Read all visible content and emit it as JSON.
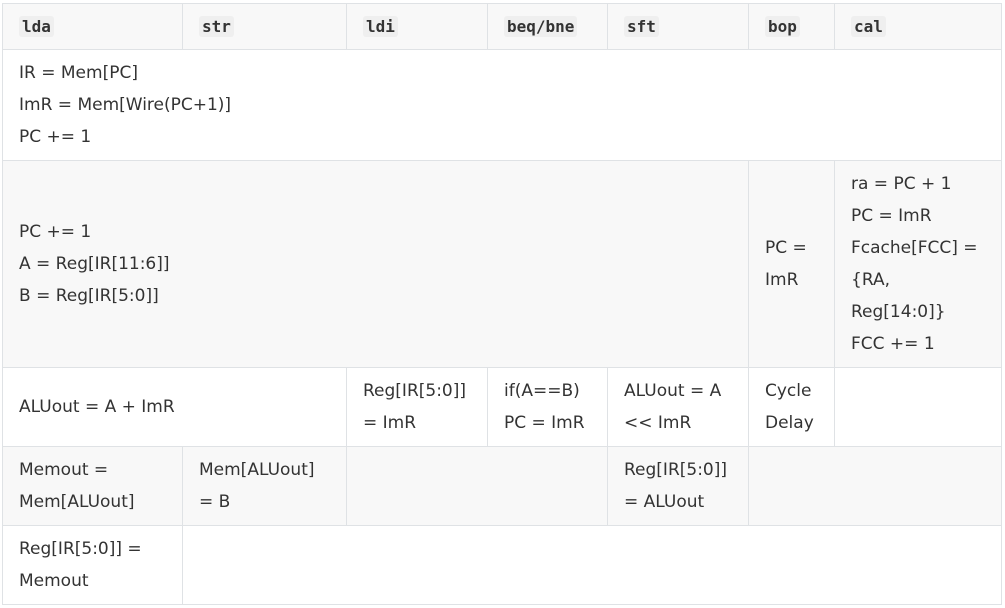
{
  "headers": [
    "lda",
    "str",
    "ldi",
    "beq/bne",
    "sft",
    "bop",
    "cal"
  ],
  "rows": {
    "fetch": [
      "IR = Mem[PC]",
      "ImR = Mem[Wire(PC+1)]",
      "PC += 1"
    ],
    "decode": {
      "common": [
        "PC += 1",
        "A = Reg[IR[11:6]]",
        "B = Reg[IR[5:0]]"
      ],
      "bop": [
        "PC =",
        "ImR"
      ],
      "cal": [
        "ra = PC + 1",
        "PC = ImR",
        "Fcache[FCC] =",
        "{RA,",
        "Reg[14:0]}",
        "FCC += 1"
      ]
    },
    "execute": {
      "lda_str": "ALUout = A + ImR",
      "ldi": [
        "Reg[IR[5:0]]",
        "= ImR"
      ],
      "beq": [
        "if(A==B)",
        "PC = ImR"
      ],
      "sft": [
        "ALUout = A",
        "<< ImR"
      ],
      "bop": [
        "Cycle",
        "Delay"
      ]
    },
    "memory": {
      "lda": [
        "Memout =",
        "Mem[ALUout]"
      ],
      "str": [
        "Mem[ALUout]",
        "= B"
      ],
      "sft": [
        "Reg[IR[5:0]]",
        "= ALUout"
      ]
    },
    "writeback": {
      "lda": [
        "Reg[IR[5:0]] =",
        "Memout"
      ]
    }
  }
}
